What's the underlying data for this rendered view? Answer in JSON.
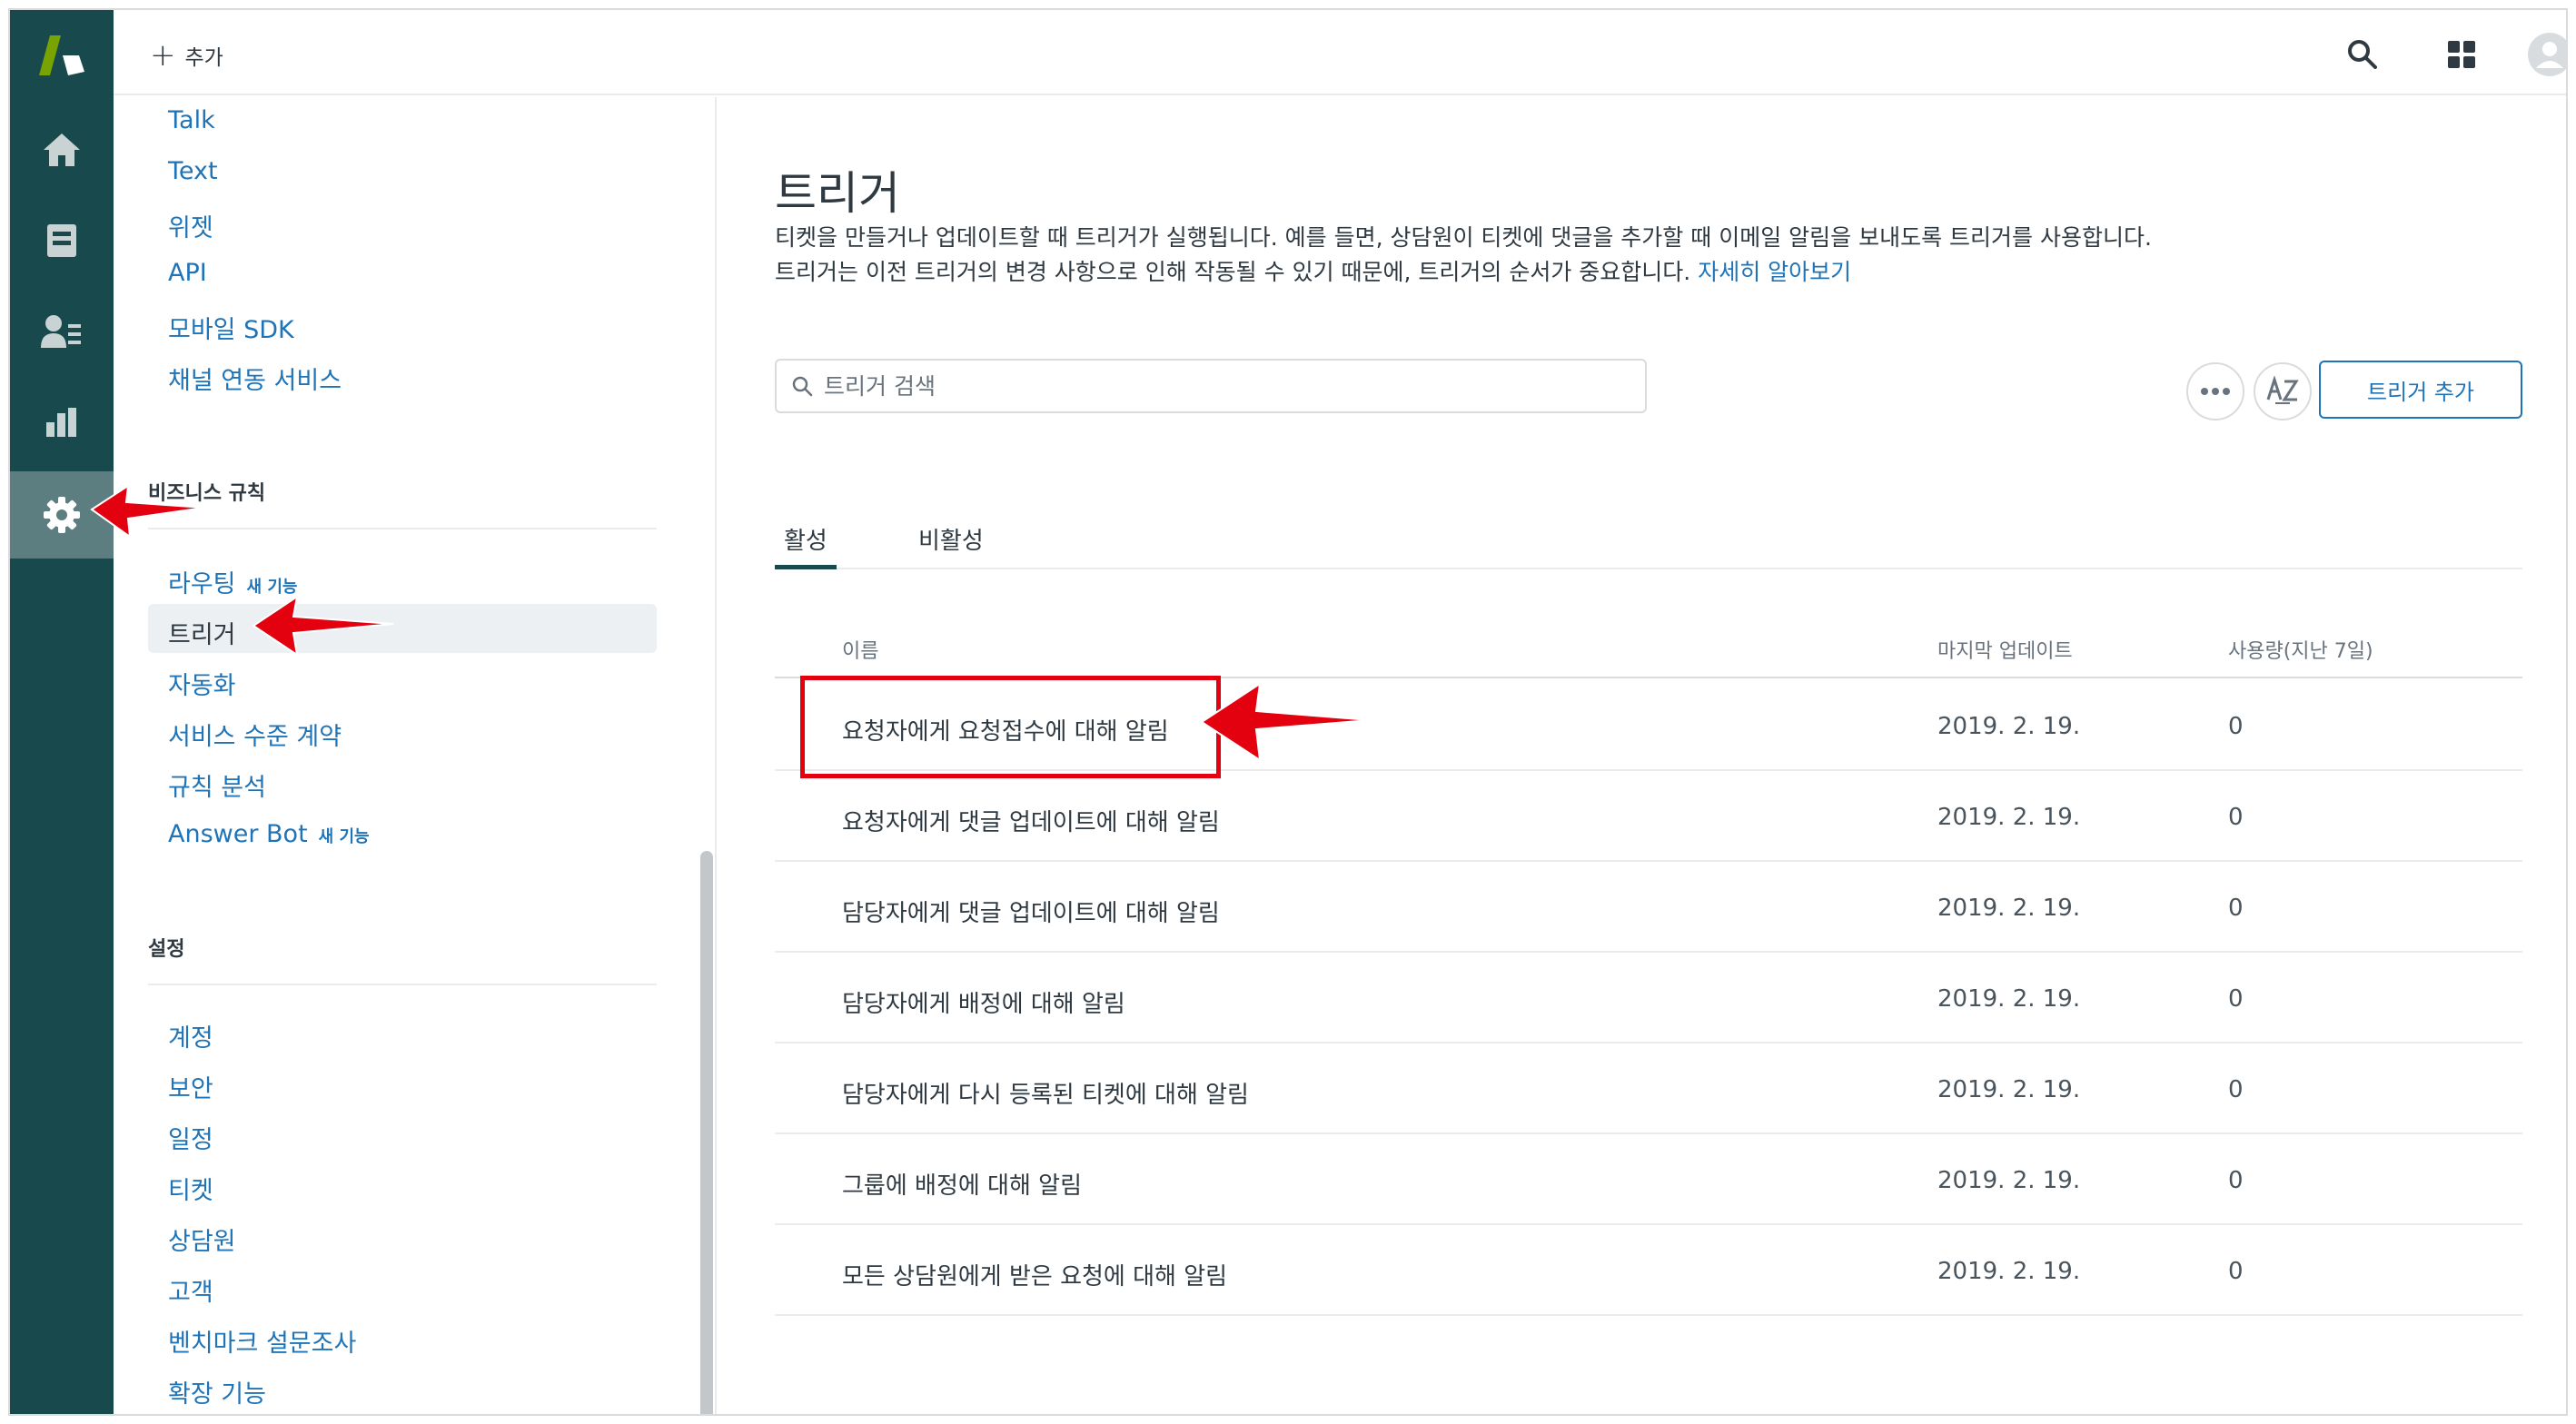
{
  "header": {
    "add_label": "추가"
  },
  "sidebar": {
    "top_links": [
      "Talk",
      "Text",
      "위젯",
      "API",
      "모바일 SDK",
      "채널 연동 서비스"
    ],
    "business_rules": {
      "heading": "비즈니스 규칙",
      "items": [
        {
          "label": "라우팅",
          "badge": "새 기능"
        },
        {
          "label": "트리거",
          "badge": ""
        },
        {
          "label": "자동화",
          "badge": ""
        },
        {
          "label": "서비스 수준 계약",
          "badge": ""
        },
        {
          "label": "규칙 분석",
          "badge": ""
        },
        {
          "label": "Answer Bot",
          "badge": "새 기능"
        }
      ]
    },
    "settings": {
      "heading": "설정",
      "items": [
        "계정",
        "보안",
        "일정",
        "티켓",
        "상담원",
        "고객",
        "벤치마크 설문조사",
        "확장 기능"
      ]
    }
  },
  "main": {
    "title": "트리거",
    "description_line1": "티켓을 만들거나 업데이트할 때 트리거가 실행됩니다. 예를 들면, 상담원이 티켓에 댓글을 추가할 때 이메일 알림을 보내도록 트리거를 사용합니다.",
    "description_line2": "트리거는 이전 트리거의 변경 사항으로 인해 작동될 수 있기 때문에, 트리거의 순서가 중요합니다.",
    "learn_more": "자세히 알아보기",
    "search_placeholder": "트리거 검색",
    "add_trigger": "트리거 추가",
    "tabs": {
      "active": "활성",
      "inactive": "비활성"
    },
    "columns": {
      "name": "이름",
      "updated": "마지막 업데이트",
      "usage": "사용량(지난 7일)"
    },
    "rows": [
      {
        "name": "요청자에게 요청접수에 대해 알림",
        "updated": "2019. 2. 19.",
        "usage": "0"
      },
      {
        "name": "요청자에게 댓글 업데이트에 대해 알림",
        "updated": "2019. 2. 19.",
        "usage": "0"
      },
      {
        "name": "담당자에게 댓글 업데이트에 대해 알림",
        "updated": "2019. 2. 19.",
        "usage": "0"
      },
      {
        "name": "담당자에게 배정에 대해 알림",
        "updated": "2019. 2. 19.",
        "usage": "0"
      },
      {
        "name": "담당자에게 다시 등록된 티켓에 대해 알림",
        "updated": "2019. 2. 19.",
        "usage": "0"
      },
      {
        "name": "그룹에 배정에 대해 알림",
        "updated": "2019. 2. 19.",
        "usage": "0"
      },
      {
        "name": "모든 상담원에게 받은 요청에 대해 알림",
        "updated": "2019. 2. 19.",
        "usage": "0"
      }
    ]
  },
  "icons": {
    "rail": [
      "zendesk-logo-icon",
      "home-icon",
      "views-icon",
      "customers-icon",
      "reporting-icon",
      "admin-gear-icon"
    ],
    "top": [
      "search-icon",
      "apps-grid-icon",
      "user-avatar-icon"
    ]
  },
  "colors": {
    "rail_bg": "#17494d",
    "rail_active": "#5d7e81",
    "link": "#1f73b7",
    "annotation_red": "#e3000f"
  }
}
